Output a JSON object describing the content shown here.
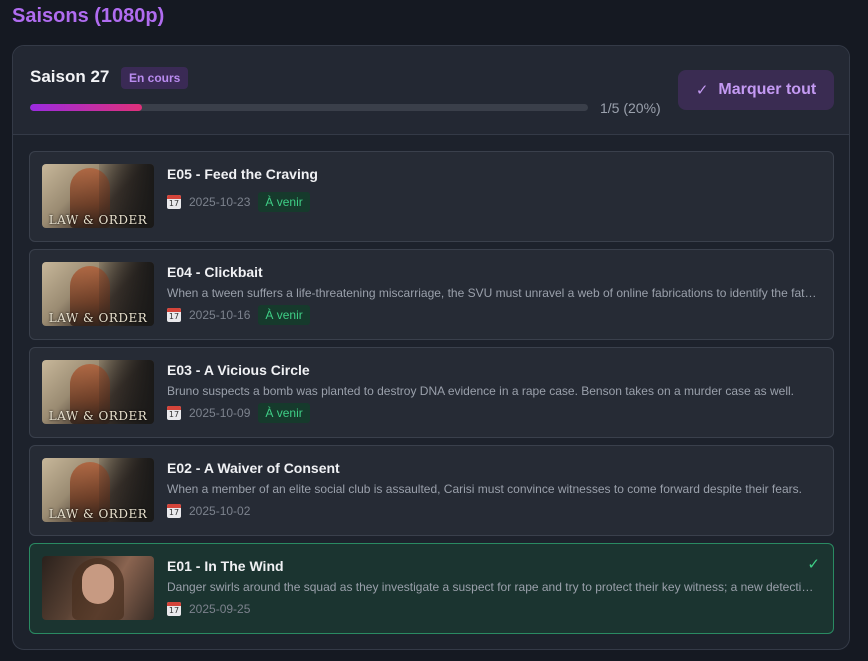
{
  "page": {
    "title": "Saisons (1080p)"
  },
  "season": {
    "title": "Saison 27",
    "status": "En cours",
    "progress_text": "1/5 (20%)",
    "progress_fraction": 0.2,
    "mark_all_label": "Marquer tout"
  },
  "episodes": [
    {
      "title": "E05 - Feed the Craving",
      "description": "",
      "date": "2025-10-23",
      "badge": "À venir",
      "watched": false,
      "thumb_text": "LAW & ORDER"
    },
    {
      "title": "E04 - Clickbait",
      "description": "When a tween suffers a life-threatening miscarriage, the SVU must unravel a web of online fabrications to identify the father.",
      "date": "2025-10-16",
      "badge": "À venir",
      "watched": false,
      "thumb_text": "LAW & ORDER"
    },
    {
      "title": "E03 - A Vicious Circle",
      "description": "Bruno suspects a bomb was planted to destroy DNA evidence in a rape case. Benson takes on a murder case as well.",
      "date": "2025-10-09",
      "badge": "À venir",
      "watched": false,
      "thumb_text": "LAW & ORDER"
    },
    {
      "title": "E02 - A Waiver of Consent",
      "description": "When a member of an elite social club is assaulted, Carisi must convince witnesses to come forward despite their fears.",
      "date": "2025-10-02",
      "badge": "",
      "watched": false,
      "thumb_text": "LAW & ORDER"
    },
    {
      "title": "E01 - In The Wind",
      "description": "Danger swirls around the squad as they investigate a suspect for rape and try to protect their key witness; a new detective arrives.",
      "date": "2025-09-25",
      "badge": "",
      "watched": true,
      "thumb_text": ""
    }
  ],
  "colors": {
    "accent": "#b06cf0",
    "progress_start": "#9b2be0",
    "progress_end": "#e0307a",
    "upcoming": "#3fcf86",
    "watched_border": "#2a8a62"
  },
  "icons": {
    "mark_all": "check-icon",
    "date": "calendar-icon",
    "watched": "check-icon"
  }
}
